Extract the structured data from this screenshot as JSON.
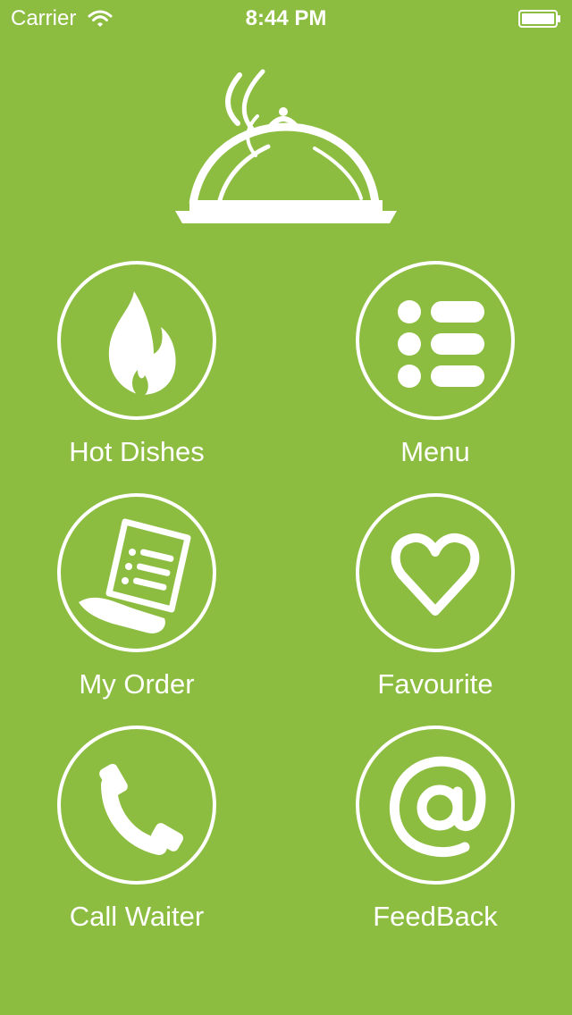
{
  "status_bar": {
    "carrier": "Carrier",
    "time": "8:44 PM"
  },
  "menu": {
    "hot_dishes": "Hot Dishes",
    "menu": "Menu",
    "my_order": "My Order",
    "favourite": "Favourite",
    "call_waiter": "Call Waiter",
    "feedback": "FeedBack"
  },
  "colors": {
    "background": "#8cbd40",
    "foreground": "#ffffff"
  }
}
